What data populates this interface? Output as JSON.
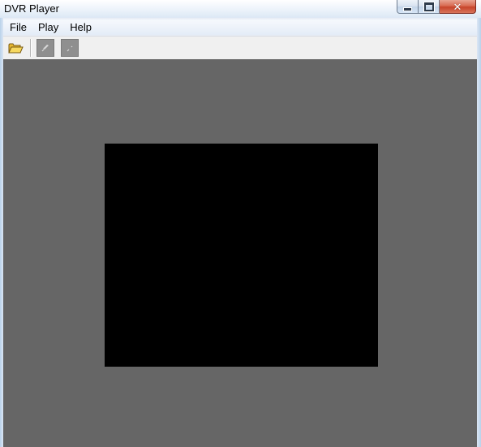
{
  "window": {
    "title": "DVR Player",
    "caption_buttons": {
      "minimize_icon": "minimize-icon",
      "maximize_icon": "maximize-icon",
      "close_icon": "close-icon",
      "close_glyph": "✕"
    }
  },
  "menubar": {
    "items": [
      {
        "label": "File"
      },
      {
        "label": "Play"
      },
      {
        "label": "Help"
      }
    ]
  },
  "toolbar": {
    "buttons": [
      {
        "icon": "open-folder-icon",
        "enabled": true
      },
      {
        "icon": "play-icon",
        "enabled": false
      },
      {
        "icon": "stop-icon",
        "enabled": false
      }
    ]
  },
  "colors": {
    "video_background": "#666666",
    "video_screen": "#000000",
    "close_button": "#c7432a",
    "folder_icon": "#f2c83c"
  }
}
